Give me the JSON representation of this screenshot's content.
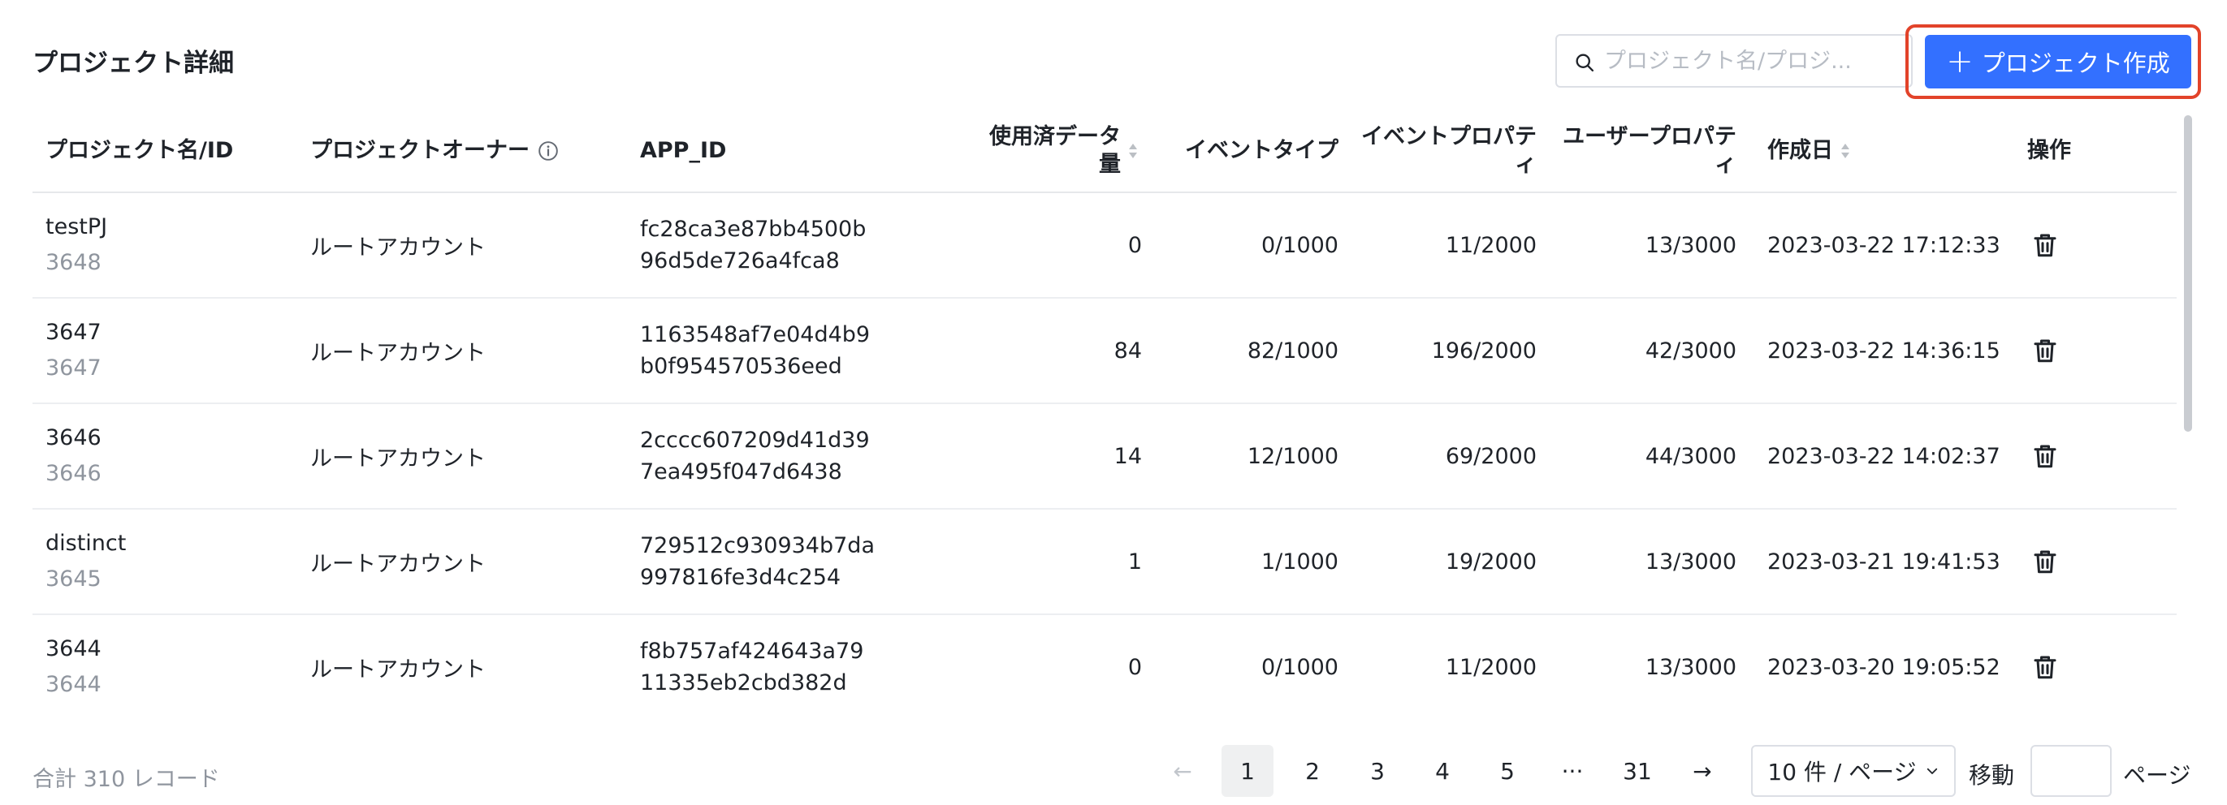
{
  "header": {
    "title": "プロジェクト詳細",
    "search_placeholder": "プロジェクト名/プロジ...",
    "create_label": "プロジェクト作成"
  },
  "columns": {
    "name": "プロジェクト名/ID",
    "owner": "プロジェクトオーナー",
    "appid": "APP_ID",
    "data_used": "使用済データ量",
    "event_type": "イベントタイプ",
    "event_prop": "イベントプロパティ",
    "user_prop": "ユーザープロパティ",
    "created": "作成日",
    "action": "操作"
  },
  "rows": [
    {
      "name": "testPJ",
      "id": "3648",
      "owner": "ルートアカウント",
      "appid": "fc28ca3e87bb4500b96d5de726a4fca8",
      "data_used": "0",
      "event_type": "0/1000",
      "event_prop": "11/2000",
      "user_prop": "13/3000",
      "created": "2023-03-22 17:12:33"
    },
    {
      "name": "3647",
      "id": "3647",
      "owner": "ルートアカウント",
      "appid": "1163548af7e04d4b9b0f954570536eed",
      "data_used": "84",
      "event_type": "82/1000",
      "event_prop": "196/2000",
      "user_prop": "42/3000",
      "created": "2023-03-22 14:36:15"
    },
    {
      "name": "3646",
      "id": "3646",
      "owner": "ルートアカウント",
      "appid": "2cccc607209d41d397ea495f047d6438",
      "data_used": "14",
      "event_type": "12/1000",
      "event_prop": "69/2000",
      "user_prop": "44/3000",
      "created": "2023-03-22 14:02:37"
    },
    {
      "name": "distinct",
      "id": "3645",
      "owner": "ルートアカウント",
      "appid": "729512c930934b7da997816fe3d4c254",
      "data_used": "1",
      "event_type": "1/1000",
      "event_prop": "19/2000",
      "user_prop": "13/3000",
      "created": "2023-03-21 19:41:53"
    },
    {
      "name": "3644",
      "id": "3644",
      "owner": "ルートアカウント",
      "appid": "f8b757af424643a7911335eb2cbd382d",
      "data_used": "0",
      "event_type": "0/1000",
      "event_prop": "11/2000",
      "user_prop": "13/3000",
      "created": "2023-03-20 19:05:52"
    }
  ],
  "footer": {
    "total": "合計 310 レコード",
    "prev": "←",
    "next": "→",
    "pages": [
      "1",
      "2",
      "3",
      "4",
      "5",
      "···",
      "31"
    ],
    "active_page": "1",
    "page_size": "10 件 / ページ",
    "goto_label": "移動",
    "goto_suffix": "ページ"
  },
  "colors": {
    "primary": "#3370ff",
    "highlight": "#e2432a"
  }
}
